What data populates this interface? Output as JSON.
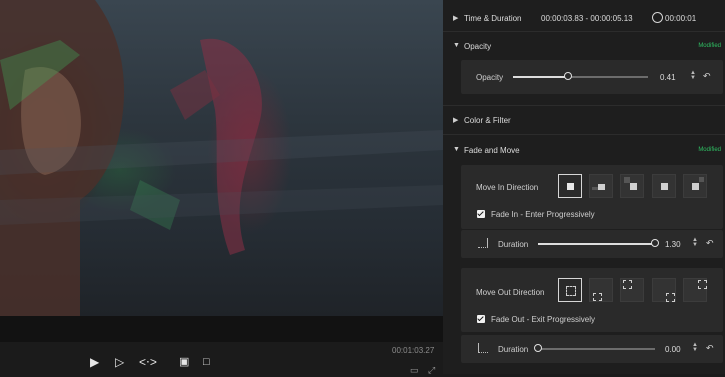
{
  "player": {
    "current_time": "00:01:03.27",
    "controls": [
      "prev-frame",
      "play",
      "trim",
      "markers",
      "snapshot",
      "render"
    ]
  },
  "panel": {
    "time_duration": {
      "title": "Time & Duration",
      "range": "00:00:03.83 - 00:00:05.13",
      "duration": "00:00:01"
    },
    "opacity": {
      "title": "Opacity",
      "status": "Modified",
      "label": "Opacity",
      "value": "0.41",
      "level": 0.41
    },
    "color_filter": {
      "title": "Color & Filter"
    },
    "fade_move": {
      "title": "Fade and Move",
      "status": "Modified",
      "move_in_label": "Move In Direction",
      "fade_in_label": "Fade In - Enter Progressively",
      "fade_in_checked": true,
      "in_duration_label": "Duration",
      "in_duration_value": "1.30",
      "in_duration_level": 1.0,
      "move_out_label": "Move Out Direction",
      "fade_out_label": "Fade Out - Exit Progressively",
      "fade_out_checked": true,
      "out_duration_label": "Duration",
      "out_duration_value": "0.00",
      "out_duration_level": 0.0
    }
  },
  "colors": {
    "modified": "#2fbf63",
    "panel_bg": "#1e1e1e",
    "card_bg": "#2a2a2a"
  }
}
